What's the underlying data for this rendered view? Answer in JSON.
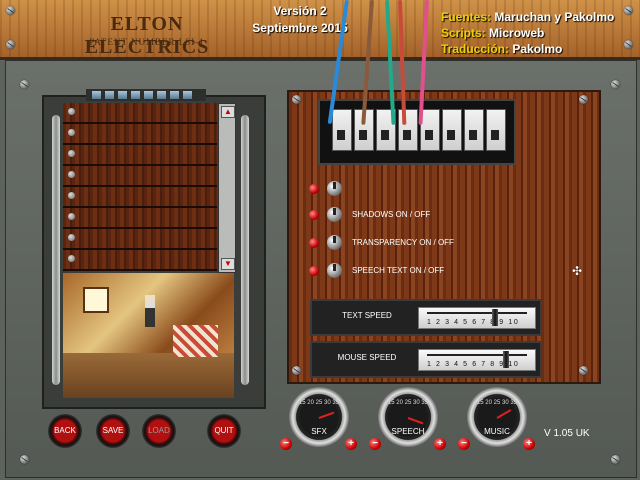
{
  "header": {
    "brand": "ELTON ELECTRICS",
    "patent": "PATENT NUMBER LSI-1",
    "version_line1": "Versión 2",
    "version_line2": "Septiembre 2015",
    "credits": [
      {
        "key": "Fuentes:",
        "value": " Maruchan y Pakolmo"
      },
      {
        "key": "Scripts:",
        "value": " Microweb"
      },
      {
        "key": "Traducción:",
        "value": " Pakolmo"
      }
    ]
  },
  "options": [
    {
      "label": ""
    },
    {
      "label": "SHADOWS   ON / OFF"
    },
    {
      "label": "TRANSPARENCY   ON / OFF"
    },
    {
      "label": "SPEECH TEXT   ON / OFF"
    }
  ],
  "sliders": {
    "scale_ticks": "1 2 3 4 5 6 7 8 9 10",
    "text_speed": {
      "label": "TEXT SPEED",
      "value": 7
    },
    "mouse_speed": {
      "label": "MOUSE SPEED",
      "value": 8
    }
  },
  "gauges": {
    "scale_numbers": "15 20 25 30 35",
    "sfx": {
      "label": "SFX",
      "minus": "−",
      "plus": "+"
    },
    "speech": {
      "label": "SPEECH",
      "minus": "−",
      "plus": "+"
    },
    "music": {
      "label": "MUSIC",
      "minus": "−",
      "plus": "+"
    }
  },
  "buttons": {
    "back": "BACK",
    "save": "SAVE",
    "load": "LOAD",
    "quit": "QUIT"
  },
  "version": "V 1.05 UK",
  "colors": {
    "credit_key": "#f0d000",
    "lamp_red": "#c40000",
    "panel_metal": "#5d625e"
  }
}
